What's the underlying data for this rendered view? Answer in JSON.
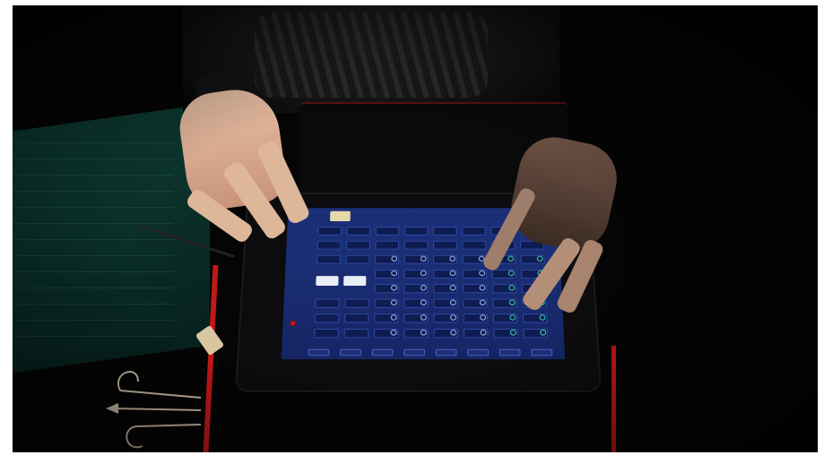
{
  "scene": {
    "description_free": true,
    "colors": {
      "background": "#050505",
      "screen": "#1b2f7a",
      "screen_cell": "#0f1c52",
      "cell_border": "#2f4aa6",
      "pad": "#e9eef6",
      "record": "#d01818",
      "cable": "#c01818",
      "skin": "#deb69a",
      "mat": "#0e3d33"
    },
    "grid": {
      "columns": 8,
      "rows": 8
    }
  }
}
